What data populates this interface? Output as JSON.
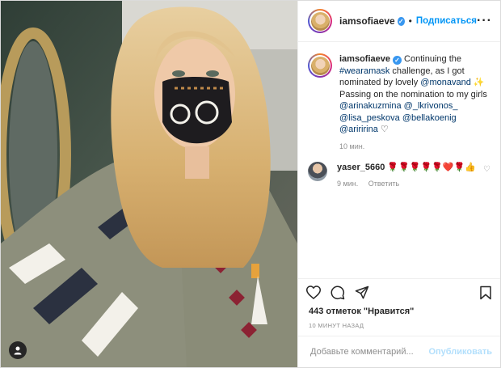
{
  "header": {
    "username": "iamsofiaeve",
    "separator": "•",
    "follow_label": "Подписаться",
    "more_label": "···"
  },
  "caption": {
    "username": "iamsofiaeve",
    "segments": [
      {
        "text": "Continuing the ",
        "link": false
      },
      {
        "text": "#wearamask",
        "link": true
      },
      {
        "text": " challenge, as I got nominated by lovely ",
        "link": false
      },
      {
        "text": "@monavand",
        "link": true
      },
      {
        "text": " ✨ Passing on the nomination to my girls ",
        "link": false
      },
      {
        "text": "@arinakuzmina",
        "link": true
      },
      {
        "text": " ",
        "link": false
      },
      {
        "text": "@_lkrivonos_",
        "link": true
      },
      {
        "text": " ",
        "link": false
      },
      {
        "text": "@lisa_peskova",
        "link": true
      },
      {
        "text": " ",
        "link": false
      },
      {
        "text": "@bellakoenig",
        "link": true
      },
      {
        "text": " ",
        "link": false
      },
      {
        "text": "@ariririna",
        "link": true
      },
      {
        "text": " ♡",
        "link": false
      }
    ],
    "timestamp": "10 мин."
  },
  "comment": {
    "username": "yaser_5660",
    "text": "🌹🌹🌹🌹🌹❤️🌹👍",
    "time": "9 мин.",
    "reply_label": "Ответить"
  },
  "likes_text": "443 отметок \"Нравится\"",
  "posted_ago": "10 МИНУТ НАЗАД",
  "add_comment": {
    "placeholder": "Добавьте комментарий...",
    "publish_label": "Опубликовать"
  },
  "colors": {
    "accent": "#0095f6",
    "publish_disabled": "#b2dffc",
    "verified": "#3897f0"
  },
  "icons": [
    "heart-icon",
    "comment-icon",
    "share-icon",
    "bookmark-icon",
    "verified-icon",
    "user-tag-icon"
  ]
}
